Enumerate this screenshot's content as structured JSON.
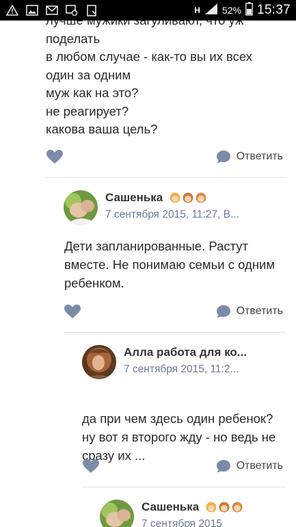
{
  "status_bar": {
    "icons": [
      "warning-icon",
      "image-icon",
      "mail-icon",
      "screenshot-icon",
      "clipboard-icon"
    ],
    "network": "H",
    "battery": "52%",
    "time": "15:37"
  },
  "top_comment": {
    "lines": [
      "лучше мужики загуливают, что уж",
      "поделать",
      "в любом случае - как-то вы их всех",
      "один за одним",
      "муж как на это?",
      "не реагирует?",
      "какова ваша цель?"
    ],
    "reply_label": "Ответить"
  },
  "comments": [
    {
      "author": "Сашенька",
      "date": "7 сентября 2015, 11:27, В...",
      "lines": [
        "Дети запланированные. Растут",
        "вместе. Не понимаю семьи с одним",
        "ребенком."
      ],
      "reply_label": "Ответить"
    },
    {
      "author": "Алла работа для ко...",
      "date": "7 сентября 2015, 11:2...",
      "lines": [
        "да при чем здесь один ребенок?",
        "ну вот я второго жду - но ведь не",
        "сразу их ..."
      ],
      "reply_label": "Ответить"
    },
    {
      "author": "Сашенька",
      "date": "7 сентября 2015",
      "lines": [],
      "reply_label": ""
    }
  ],
  "colors": {
    "accent_icon": "#7c8ba8",
    "date_text": "#6a7a99",
    "separator": "#e4e4e4"
  }
}
